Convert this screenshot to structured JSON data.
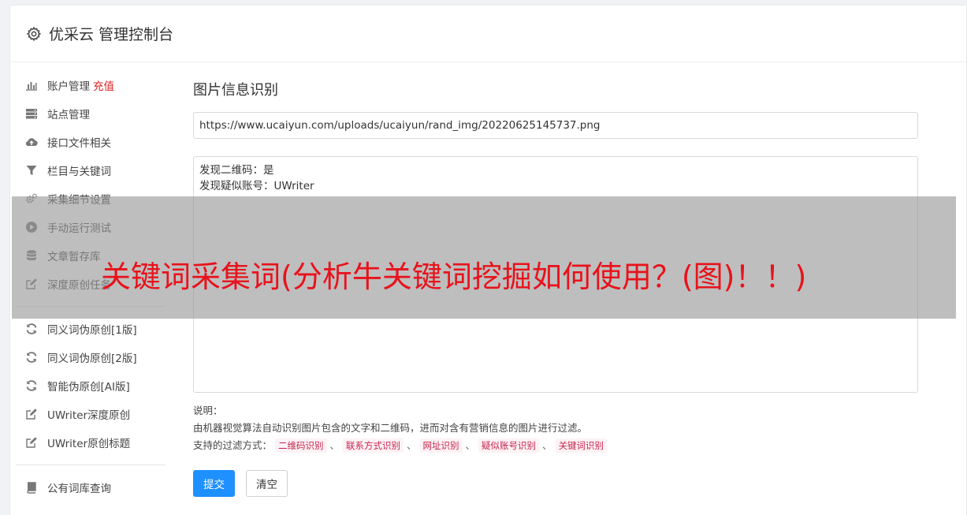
{
  "header": {
    "title": "优采云 管理控制台",
    "icon": "gear-icon"
  },
  "sidebar": {
    "group1": [
      {
        "label": "账户管理",
        "badge": "充值",
        "icon": "bar-chart-icon"
      },
      {
        "label": "站点管理",
        "icon": "server-icon"
      },
      {
        "label": "接口文件相关",
        "icon": "cloud-upload-icon"
      },
      {
        "label": "栏目与关键词",
        "icon": "filter-icon"
      },
      {
        "label": "采集细节设置",
        "icon": "cogs-icon"
      },
      {
        "label": "手动运行测试",
        "icon": "play-circle-icon"
      },
      {
        "label": "文章暂存库",
        "icon": "database-icon"
      },
      {
        "label": "深度原创任务",
        "icon": "edit-icon"
      }
    ],
    "group2": [
      {
        "label": "同义词伪原创[1版]",
        "icon": "refresh-icon"
      },
      {
        "label": "同义词伪原创[2版]",
        "icon": "refresh-icon"
      },
      {
        "label": "智能伪原创[AI版]",
        "icon": "refresh-icon"
      },
      {
        "label": "UWriter深度原创",
        "icon": "edit-icon"
      },
      {
        "label": "UWriter原创标题",
        "icon": "edit-icon"
      }
    ],
    "group3": [
      {
        "label": "公有词库查询",
        "icon": "book-icon"
      }
    ]
  },
  "main": {
    "title": "图片信息识别",
    "url_value": "https://www.ucaiyun.com/uploads/ucaiyun/rand_img/20220625145737.png",
    "result_lines": [
      "发现二维码：是",
      "发现疑似账号：UWriter"
    ],
    "desc_label": "说明：",
    "desc_text": "由机器视觉算法自动识别图片包含的文字和二维码，进而对含有营销信息的图片进行过滤。",
    "filter_label": "支持的过滤方式：",
    "filters": [
      "二维码识别",
      "联系方式识别",
      "网址识别",
      "疑似账号识别",
      "关键词识别"
    ],
    "filter_sep": "、",
    "submit_label": "提交",
    "clear_label": "清空"
  },
  "overlay": {
    "text": "关键词采集词(分析牛关键词挖掘如何使用？(图)！！)"
  },
  "colors": {
    "primary": "#1e90ff",
    "overlay_text": "#e8121b",
    "tag_text": "#c7254e",
    "badge": "#e02020"
  }
}
